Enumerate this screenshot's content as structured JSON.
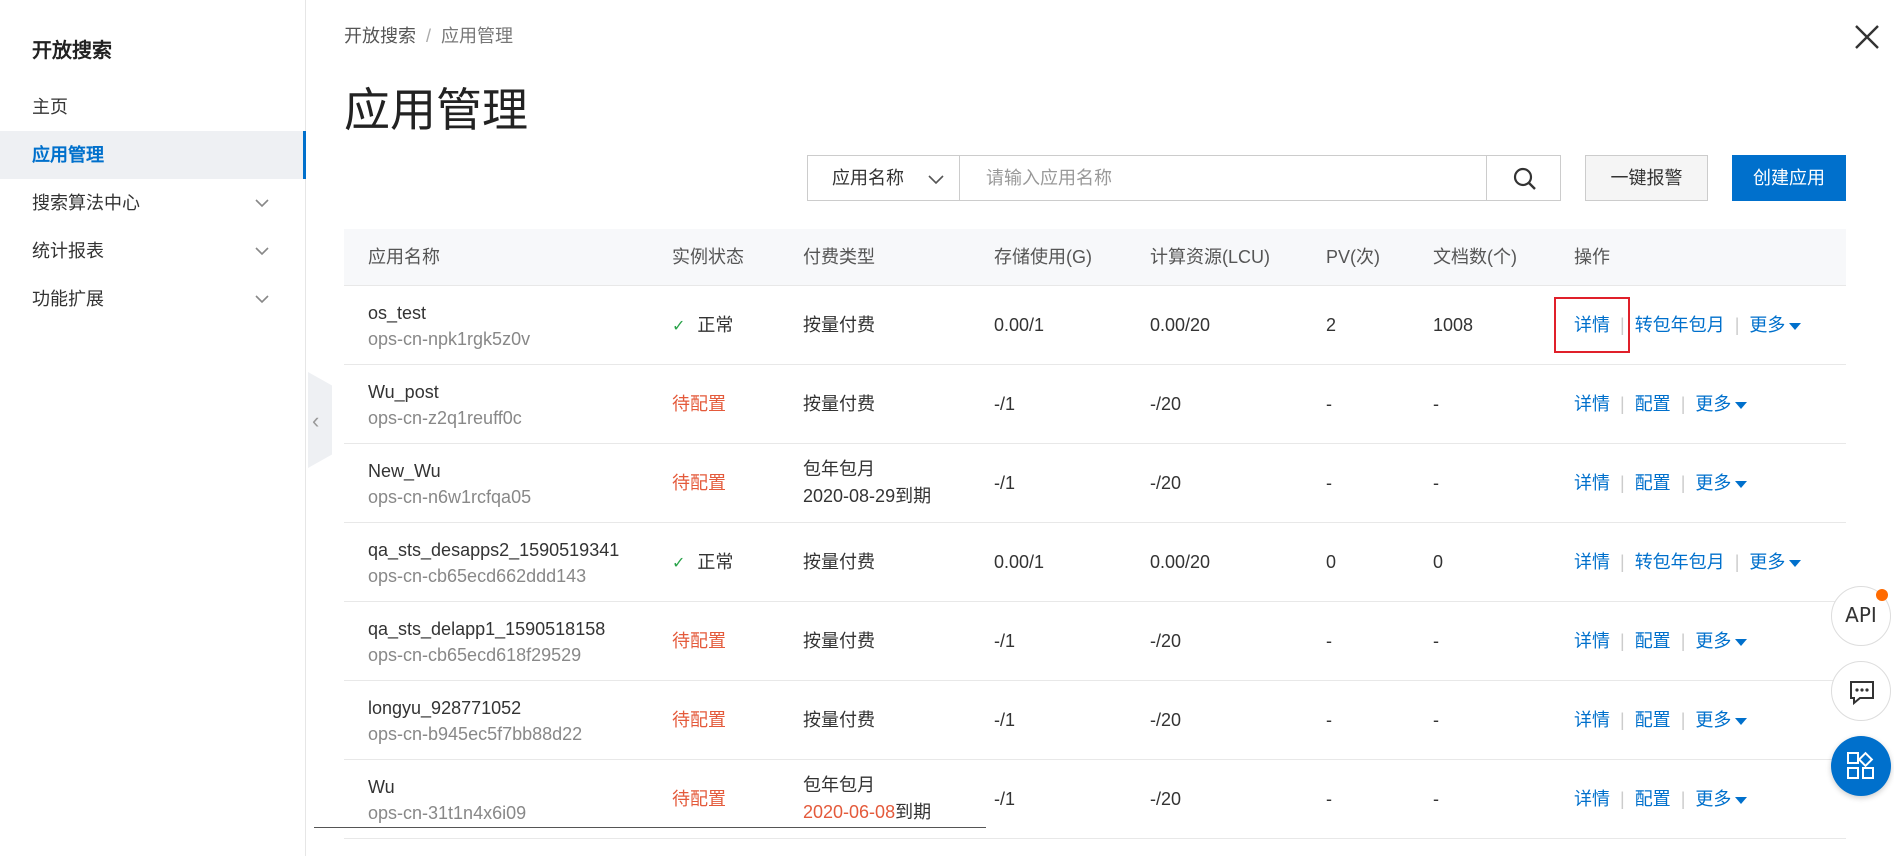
{
  "sidebar": {
    "title": "开放搜索",
    "items": [
      {
        "label": "主页",
        "active": false,
        "expandable": false
      },
      {
        "label": "应用管理",
        "active": true,
        "expandable": false
      },
      {
        "label": "搜索算法中心",
        "active": false,
        "expandable": true
      },
      {
        "label": "统计报表",
        "active": false,
        "expandable": true
      },
      {
        "label": "功能扩展",
        "active": false,
        "expandable": true
      }
    ]
  },
  "breadcrumb": {
    "root": "开放搜索",
    "separator": "/",
    "current": "应用管理"
  },
  "page_title": "应用管理",
  "toolbar": {
    "select_value": "应用名称",
    "search_placeholder": "请输入应用名称",
    "alarm_label": "一键报警",
    "create_label": "创建应用"
  },
  "table": {
    "headers": [
      "应用名称",
      "实例状态",
      "付费类型",
      "存储使用(G)",
      "计算资源(LCU)",
      "PV(次)",
      "文档数(个)",
      "操作"
    ],
    "rows": [
      {
        "name": "os_test",
        "id": "ops-cn-npk1rgk5z0v",
        "status": "正常",
        "status_ok": true,
        "pay": "按量付费",
        "pay_date": "",
        "pay_suffix": "",
        "storage": "0.00/1",
        "lcu": "0.00/20",
        "pv": "2",
        "docs": "1008",
        "op1": "详情",
        "op2": "转包年包月",
        "op3": "更多"
      },
      {
        "name": "Wu_post",
        "id": "ops-cn-z2q1reuff0c",
        "status": "待配置",
        "status_ok": false,
        "pay": "按量付费",
        "pay_date": "",
        "pay_suffix": "",
        "storage": "-/1",
        "lcu": "-/20",
        "pv": "-",
        "docs": "-",
        "op1": "详情",
        "op2": "配置",
        "op3": "更多"
      },
      {
        "name": "New_Wu",
        "id": "ops-cn-n6w1rcfqa05",
        "status": "待配置",
        "status_ok": false,
        "pay": "包年包月",
        "pay_date": "2020-08-29",
        "pay_suffix": "到期",
        "pay_date_red": false,
        "storage": "-/1",
        "lcu": "-/20",
        "pv": "-",
        "docs": "-",
        "op1": "详情",
        "op2": "配置",
        "op3": "更多"
      },
      {
        "name": "qa_sts_desapps2_1590519341",
        "id": "ops-cn-cb65ecd662ddd143",
        "status": "正常",
        "status_ok": true,
        "pay": "按量付费",
        "pay_date": "",
        "pay_suffix": "",
        "storage": "0.00/1",
        "lcu": "0.00/20",
        "pv": "0",
        "docs": "0",
        "op1": "详情",
        "op2": "转包年包月",
        "op3": "更多"
      },
      {
        "name": "qa_sts_delapp1_1590518158",
        "id": "ops-cn-cb65ecd618f29529",
        "status": "待配置",
        "status_ok": false,
        "pay": "按量付费",
        "pay_date": "",
        "pay_suffix": "",
        "storage": "-/1",
        "lcu": "-/20",
        "pv": "-",
        "docs": "-",
        "op1": "详情",
        "op2": "配置",
        "op3": "更多"
      },
      {
        "name": "longyu_928771052",
        "id": "ops-cn-b945ec5f7bb88d22",
        "status": "待配置",
        "status_ok": false,
        "pay": "按量付费",
        "pay_date": "",
        "pay_suffix": "",
        "storage": "-/1",
        "lcu": "-/20",
        "pv": "-",
        "docs": "-",
        "op1": "详情",
        "op2": "配置",
        "op3": "更多"
      },
      {
        "name": "Wu",
        "id": "ops-cn-31t1n4x6i09",
        "status": "待配置",
        "status_ok": false,
        "pay": "包年包月",
        "pay_date": "2020-06-08",
        "pay_suffix": "到期",
        "pay_date_red": true,
        "storage": "-/1",
        "lcu": "-/20",
        "pv": "-",
        "docs": "-",
        "op1": "详情",
        "op2": "配置",
        "op3": "更多"
      }
    ]
  },
  "widgets": {
    "api_label": "API"
  },
  "colors": {
    "accent": "#0070cc",
    "pending": "#e45a3b",
    "ok_check": "#2aa34a",
    "highlight": "#e0202a"
  },
  "icons": [
    "close-icon",
    "chevron-down-icon",
    "search-icon",
    "check-icon",
    "caret-down-icon",
    "chat-icon",
    "apps-grid-icon",
    "chevron-left-icon"
  ]
}
